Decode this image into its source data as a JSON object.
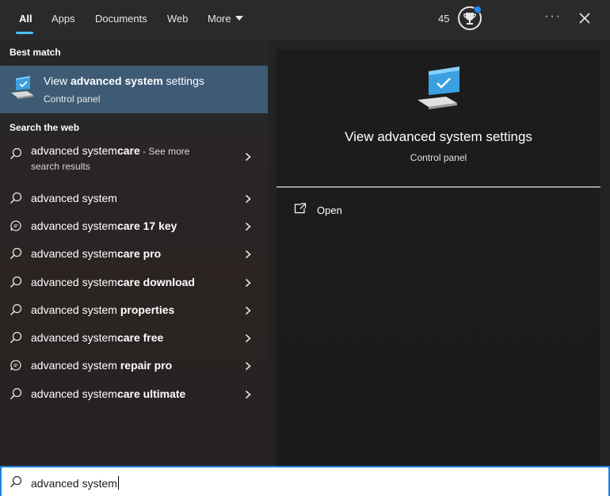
{
  "tabs": [
    {
      "label": "All",
      "active": true
    },
    {
      "label": "Apps"
    },
    {
      "label": "Documents"
    },
    {
      "label": "Web"
    },
    {
      "label": "More"
    }
  ],
  "header": {
    "points": "45",
    "accent_color": "#4cc2ff",
    "icons": [
      "trophy-icon",
      "more-options-icon",
      "close-icon"
    ]
  },
  "best_match": {
    "section_title": "Best match",
    "title_plain_1": "View ",
    "title_bold": "advanced system",
    "title_plain_2": " settings",
    "subtitle": "Control panel",
    "highlight_color": "#3e5a75"
  },
  "web": {
    "section_title": "Search the web",
    "results": [
      {
        "plain": "advanced system",
        "bold": "care",
        "suffix": " - See more",
        "sub": "search results",
        "icon": "search-icon"
      },
      {
        "plain": "advanced system",
        "bold": "",
        "icon": "search-icon"
      },
      {
        "plain": "advanced system",
        "bold": "care 17 key",
        "icon": "chat-icon"
      },
      {
        "plain": "advanced system",
        "bold": "care pro",
        "icon": "search-icon"
      },
      {
        "plain": "advanced system",
        "bold": "care download",
        "icon": "search-icon"
      },
      {
        "plain": "advanced system ",
        "bold": "properties",
        "icon": "search-icon"
      },
      {
        "plain": "advanced system",
        "bold": "care free",
        "icon": "search-icon"
      },
      {
        "plain": "advanced system ",
        "bold": "repair pro",
        "icon": "chat-icon"
      },
      {
        "plain": "advanced system",
        "bold": "care ultimate",
        "icon": "search-icon"
      }
    ]
  },
  "preview": {
    "title": "View advanced system settings",
    "subtitle": "Control panel",
    "actions": [
      {
        "label": "Open",
        "icon": "open-external-icon"
      }
    ]
  },
  "search": {
    "value": "advanced system",
    "border_color": "#1e7fd8"
  }
}
